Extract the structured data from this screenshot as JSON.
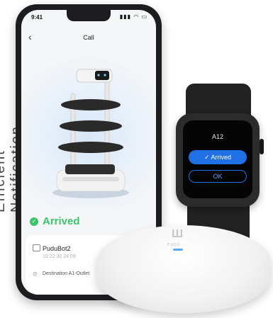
{
  "side_text": "Efficient Notification",
  "phone": {
    "status_time": "9:41",
    "nav_title": "Call",
    "arrived_label": "Arrived",
    "robot_name": "PuduBot2",
    "timestamp": "10:22:30 24:09",
    "destination": "Destination A1-Outlet"
  },
  "watch": {
    "title": "A12",
    "arrived_button": "✓ Arrived",
    "ok_button": "OK"
  },
  "pager": {
    "logo": "Ш",
    "logo_sub": "PUDU"
  },
  "colors": {
    "accent_green": "#3ec46d",
    "watch_blue": "#1f6fe5"
  },
  "icons": [
    "back-chevron-icon",
    "robot-icon",
    "location-pin-icon",
    "check-icon",
    "signal-icon",
    "wifi-icon",
    "battery-icon"
  ]
}
